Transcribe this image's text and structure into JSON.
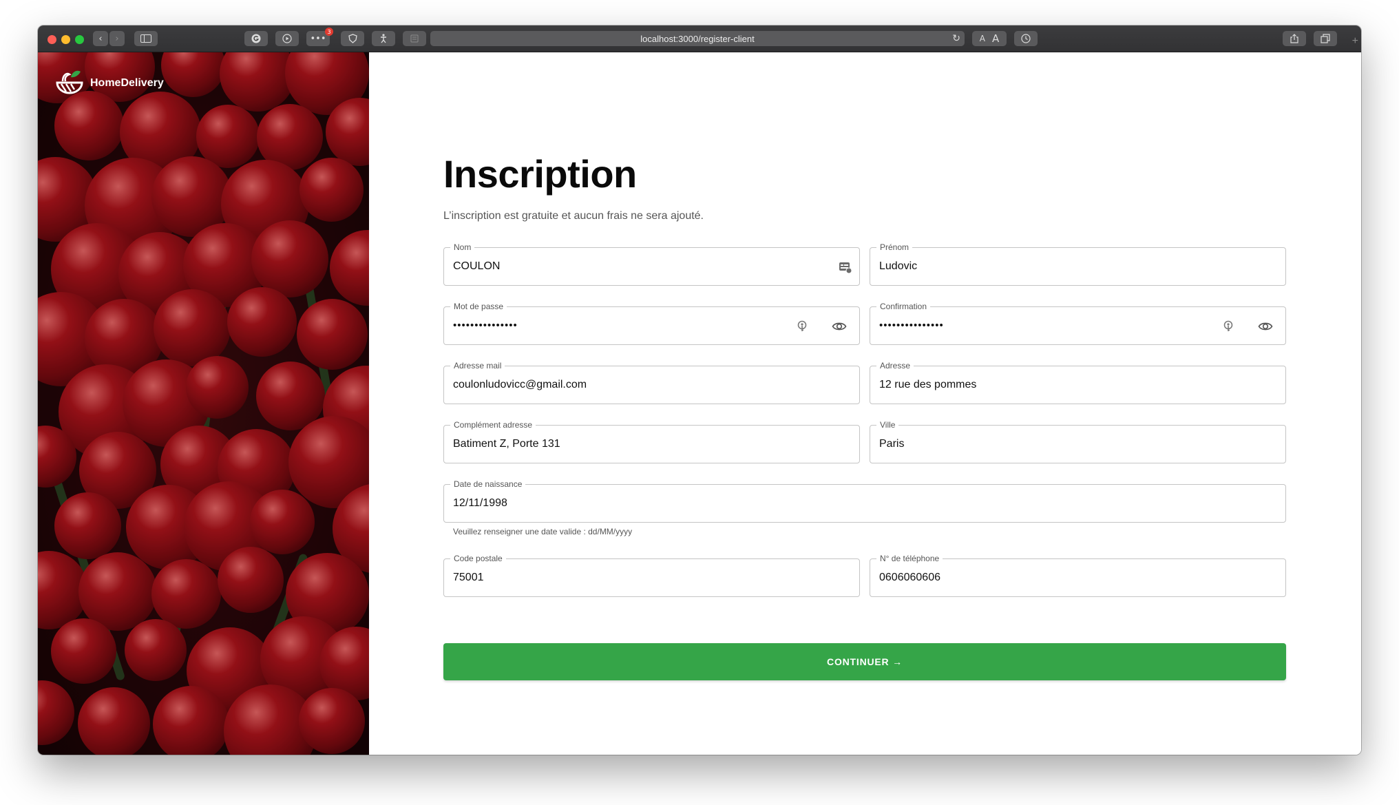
{
  "browser": {
    "url": "localhost:3000/register-client",
    "extension_badge_count": "3",
    "text_smaller": "A",
    "text_larger": "A"
  },
  "brand": {
    "name": "HomeDelivery",
    "icon": "bowl-leaf-logo-icon"
  },
  "page": {
    "title": "Inscription",
    "subtitle": "L’inscription est gratuite et aucun frais ne sera ajouté."
  },
  "form": {
    "nom": {
      "label": "Nom",
      "value": "COULON"
    },
    "prenom": {
      "label": "Prénom",
      "value": "Ludovic"
    },
    "password": {
      "label": "Mot de passe",
      "value": "•••••••••••••••"
    },
    "confirmation": {
      "label": "Confirmation",
      "value": "•••••••••••••••"
    },
    "email": {
      "label": "Adresse mail",
      "value": "coulonludovicc@gmail.com"
    },
    "adresse": {
      "label": "Adresse",
      "value": "12 rue des pommes"
    },
    "complement": {
      "label": "Complément adresse",
      "value": "Batiment Z, Porte 131"
    },
    "ville": {
      "label": "Ville",
      "value": "Paris"
    },
    "naissance": {
      "label": "Date de naissance",
      "value": "12/11/1998",
      "helper": "Veuillez renseigner une date valide : dd/MM/yyyy"
    },
    "code_postal": {
      "label": "Code postale",
      "value": "75001"
    },
    "telephone": {
      "label": "N° de téléphone",
      "value": "0606060606"
    },
    "submit_label": "CONTINUER →"
  },
  "colors": {
    "accent": "#35a548",
    "border": "#c4c4c4",
    "tomato": "#b3141c"
  }
}
